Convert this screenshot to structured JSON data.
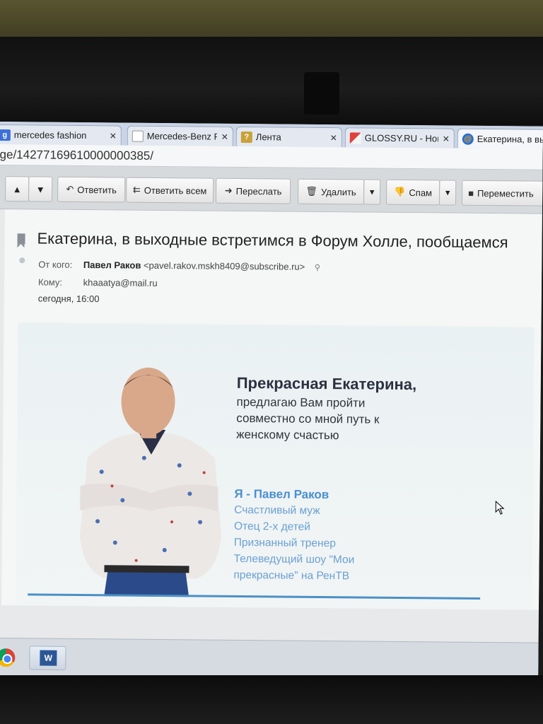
{
  "tabs": [
    {
      "title": "mercedes fashion",
      "favicon": "google-icon",
      "active": false
    },
    {
      "title": "Mercedes-Benz F",
      "favicon": "page-icon",
      "active": false
    },
    {
      "title": "Лента",
      "favicon": "question-icon",
      "active": false
    },
    {
      "title": "GLOSSY.RU - Нов",
      "favicon": "glossy-icon",
      "active": false
    },
    {
      "title": "Екатерина, в вы",
      "favicon": "mailru-icon",
      "active": true
    }
  ],
  "address_bar": {
    "url": "ge/14277169610000000385/"
  },
  "toolbar": {
    "reply": "Ответить",
    "reply_all": "Ответить всем",
    "forward": "Переслать",
    "delete": "Удалить",
    "spam": "Спам",
    "move": "Переместить"
  },
  "message": {
    "subject": "Екатерина, в выходные встретимся в Форум Холле, пообщаемся",
    "from_label": "От кого:",
    "from_name": "Павел Раков",
    "from_email": "<pavel.rakov.mskh8409@subscribe.ru>",
    "to_label": "Кому:",
    "to_email": "khaaatya@mail.ru",
    "date": "сегодня, 16:00"
  },
  "banner": {
    "headline": "Прекрасная Екатерина,",
    "subline": [
      "предлагаю Вам пройти",
      "совместно со мной путь к",
      "женскому счастью"
    ],
    "name": "Я - Павел Раков",
    "facts": [
      "Счастливый муж",
      "Отец 2-х детей",
      "Признанный тренер",
      "Телеведущий шоу \"Мои",
      "прекрасные\" на РенТВ"
    ]
  },
  "colors": {
    "accent_blue": "#4a8fd0",
    "fact_blue": "#6aa0d2",
    "rule_blue": "#4a90c8"
  }
}
